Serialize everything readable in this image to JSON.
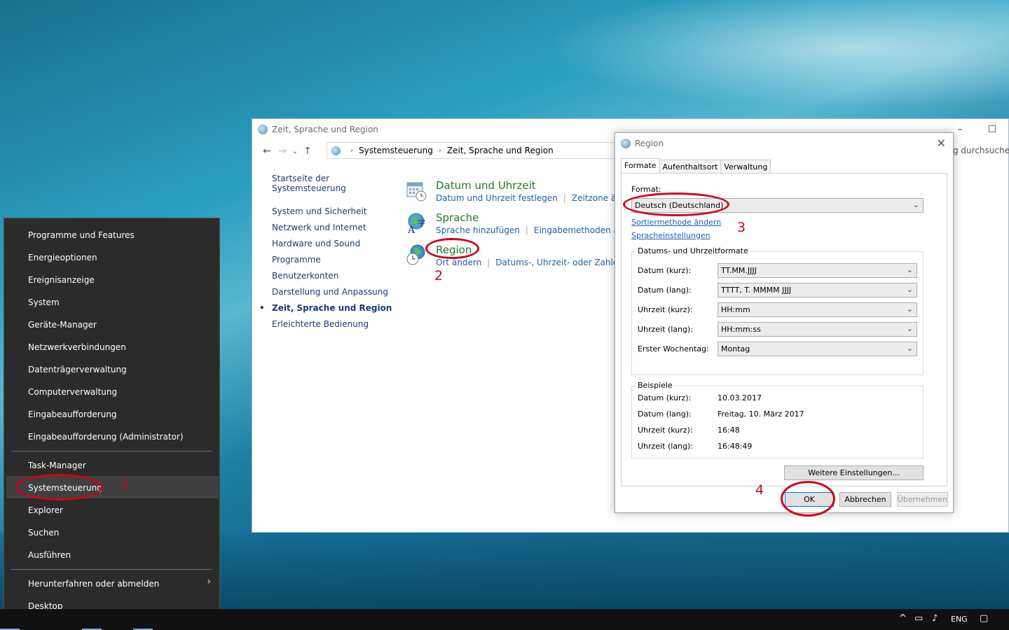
{
  "control_panel": {
    "window_title": "Zeit, Sprache und Region",
    "breadcrumb": [
      "Systemsteuerung",
      "Zeit, Sprache und Region"
    ],
    "search_placeholder": "g durchsuchen",
    "sidebar": {
      "home": "Startseite der Systemsteuerung",
      "items": [
        "System und Sicherheit",
        "Netzwerk und Internet",
        "Hardware und Sound",
        "Programme",
        "Benutzerkonten",
        "Darstellung und Anpassung",
        "Zeit, Sprache und Region",
        "Erleichterte Bedienung"
      ]
    },
    "categories": [
      {
        "title": "Datum und Uhrzeit",
        "links": [
          "Datum und Uhrzeit festlegen",
          "Zeitzone ändern"
        ]
      },
      {
        "title": "Sprache",
        "links": [
          "Sprache hinzufügen",
          "Eingabemethoden änder"
        ]
      },
      {
        "title": "Region",
        "links": [
          "Ort ändern",
          "Datums-, Uhrzeit- oder Zahlenfor"
        ]
      }
    ]
  },
  "region_dialog": {
    "title": "Region",
    "tabs": [
      "Formate",
      "Aufenthaltsort",
      "Verwaltung"
    ],
    "format_label": "Format:",
    "format_value": "Deutsch (Deutschland)",
    "link_sort": "Sortiermethode ändern",
    "link_lang": "Spracheinstellungen",
    "date_time_group_title": "Datums- und Uhrzeitformate",
    "formats": [
      {
        "label": "Datum (kurz):",
        "value": "TT.MM.JJJJ"
      },
      {
        "label": "Datum (lang):",
        "value": "TTTT, T. MMMM JJJJ"
      },
      {
        "label": "Uhrzeit (kurz):",
        "value": "HH:mm"
      },
      {
        "label": "Uhrzeit (lang):",
        "value": "HH:mm:ss"
      },
      {
        "label": "Erster Wochentag:",
        "value": "Montag"
      }
    ],
    "examples_group_title": "Beispiele",
    "examples": [
      {
        "label": "Datum (kurz):",
        "value": "10.03.2017"
      },
      {
        "label": "Datum (lang):",
        "value": "Freitag, 10. März 2017"
      },
      {
        "label": "Uhrzeit (kurz):",
        "value": "16:48"
      },
      {
        "label": "Uhrzeit (lang):",
        "value": "16:48:49"
      }
    ],
    "more_settings": "Weitere Einstellungen...",
    "ok": "OK",
    "cancel": "Abbrechen",
    "apply": "Übernehmen"
  },
  "winx_menu": {
    "group1": [
      "Programme und Features",
      "Energieoptionen",
      "Ereignisanzeige",
      "System",
      "Geräte-Manager",
      "Netzwerkverbindungen",
      "Datenträgerverwaltung",
      "Computerverwaltung",
      "Eingabeaufforderung",
      "Eingabeaufforderung (Administrator)"
    ],
    "group2": [
      "Task-Manager",
      "Systemsteuerung",
      "Explorer",
      "Suchen",
      "Ausführen"
    ],
    "group3": [
      "Herunterfahren oder abmelden",
      "Desktop"
    ]
  },
  "annotations": {
    "n1": "1",
    "n2": "2",
    "n3": "3",
    "n4": "4"
  },
  "taskbar": {
    "language": "ENG"
  },
  "colors": {
    "annotation_red": "#d0021b",
    "link_blue": "#1a5fb4",
    "category_green": "#1e7a27",
    "menu_bg": "#2b2b2b"
  }
}
